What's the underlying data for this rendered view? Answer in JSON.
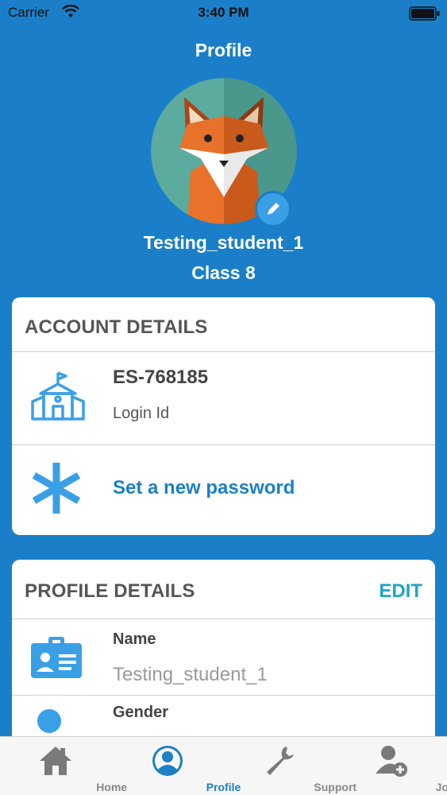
{
  "status_bar": {
    "carrier": "Carrier",
    "time": "3:40 PM"
  },
  "header": {
    "title": "Profile"
  },
  "user": {
    "username": "Testing_student_1",
    "class_name": "Class 8",
    "avatar": "fox-avatar",
    "edit_icon": "pencil-icon"
  },
  "account_details": {
    "title": "ACCOUNT DETAILS",
    "login": {
      "value": "ES-768185",
      "label": "Login Id",
      "icon": "school-icon"
    },
    "password": {
      "label": "Set a new password",
      "icon": "asterisk-icon"
    }
  },
  "profile_details": {
    "title": "PROFILE DETAILS",
    "edit_label": "EDIT",
    "fields": [
      {
        "label": "Name",
        "value": "Testing_student_1",
        "icon": "id-card-icon"
      },
      {
        "label": "Gender",
        "value": "",
        "icon": "person-icon"
      }
    ]
  },
  "tabbar": {
    "tabs": [
      {
        "label": "Home",
        "icon": "home-icon"
      },
      {
        "label": "Profile",
        "icon": "profile-icon",
        "active": true
      },
      {
        "label": "Support",
        "icon": "wrench-icon"
      },
      {
        "label": "Join",
        "icon": "add-user-icon"
      }
    ]
  },
  "colors": {
    "background": "#1a7fc8",
    "accent": "#1b80c4",
    "edit": "#1fa3c9"
  }
}
